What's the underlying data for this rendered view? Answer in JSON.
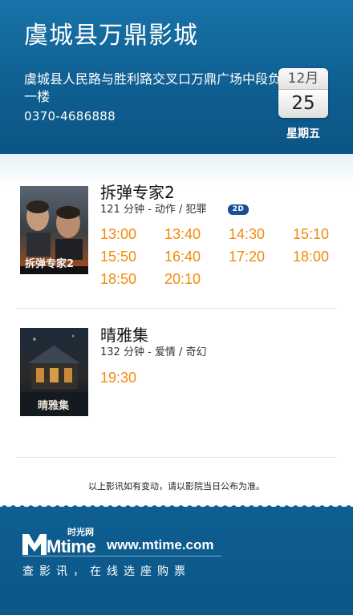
{
  "header": {
    "cinema_name": "虞城县万鼎影城",
    "address": "虞城县人民路与胜利路交叉口万鼎广场中段负一楼",
    "phone": "0370-4686888",
    "calendar": {
      "month": "12月",
      "day": "25",
      "weekday": "星期五"
    }
  },
  "movies": [
    {
      "title": "拆弹专家2",
      "info": "121 分钟 - 动作 / 犯罪",
      "format_badge": "2D",
      "poster_text": "拆弹专家2",
      "showtimes": [
        "13:00",
        "13:40",
        "14:30",
        "15:10",
        "15:50",
        "16:40",
        "17:20",
        "18:00",
        "18:50",
        "20:10"
      ]
    },
    {
      "title": "晴雅集",
      "info": "132 分钟 - 爱情 / 奇幻",
      "poster_text": "晴雅集",
      "showtimes": [
        "19:30"
      ]
    }
  ],
  "notice": "以上影讯如有变动，请以影院当日公布为准。",
  "footer": {
    "logo_cn": "时光网",
    "logo_en": "Mtime",
    "url": "www.mtime.com",
    "slogan": "查影讯，在线选座购票"
  },
  "colors": {
    "header_blue": "#0f5f92",
    "showtime_orange": "#f08a0c",
    "badge_blue": "#1a4f98"
  }
}
